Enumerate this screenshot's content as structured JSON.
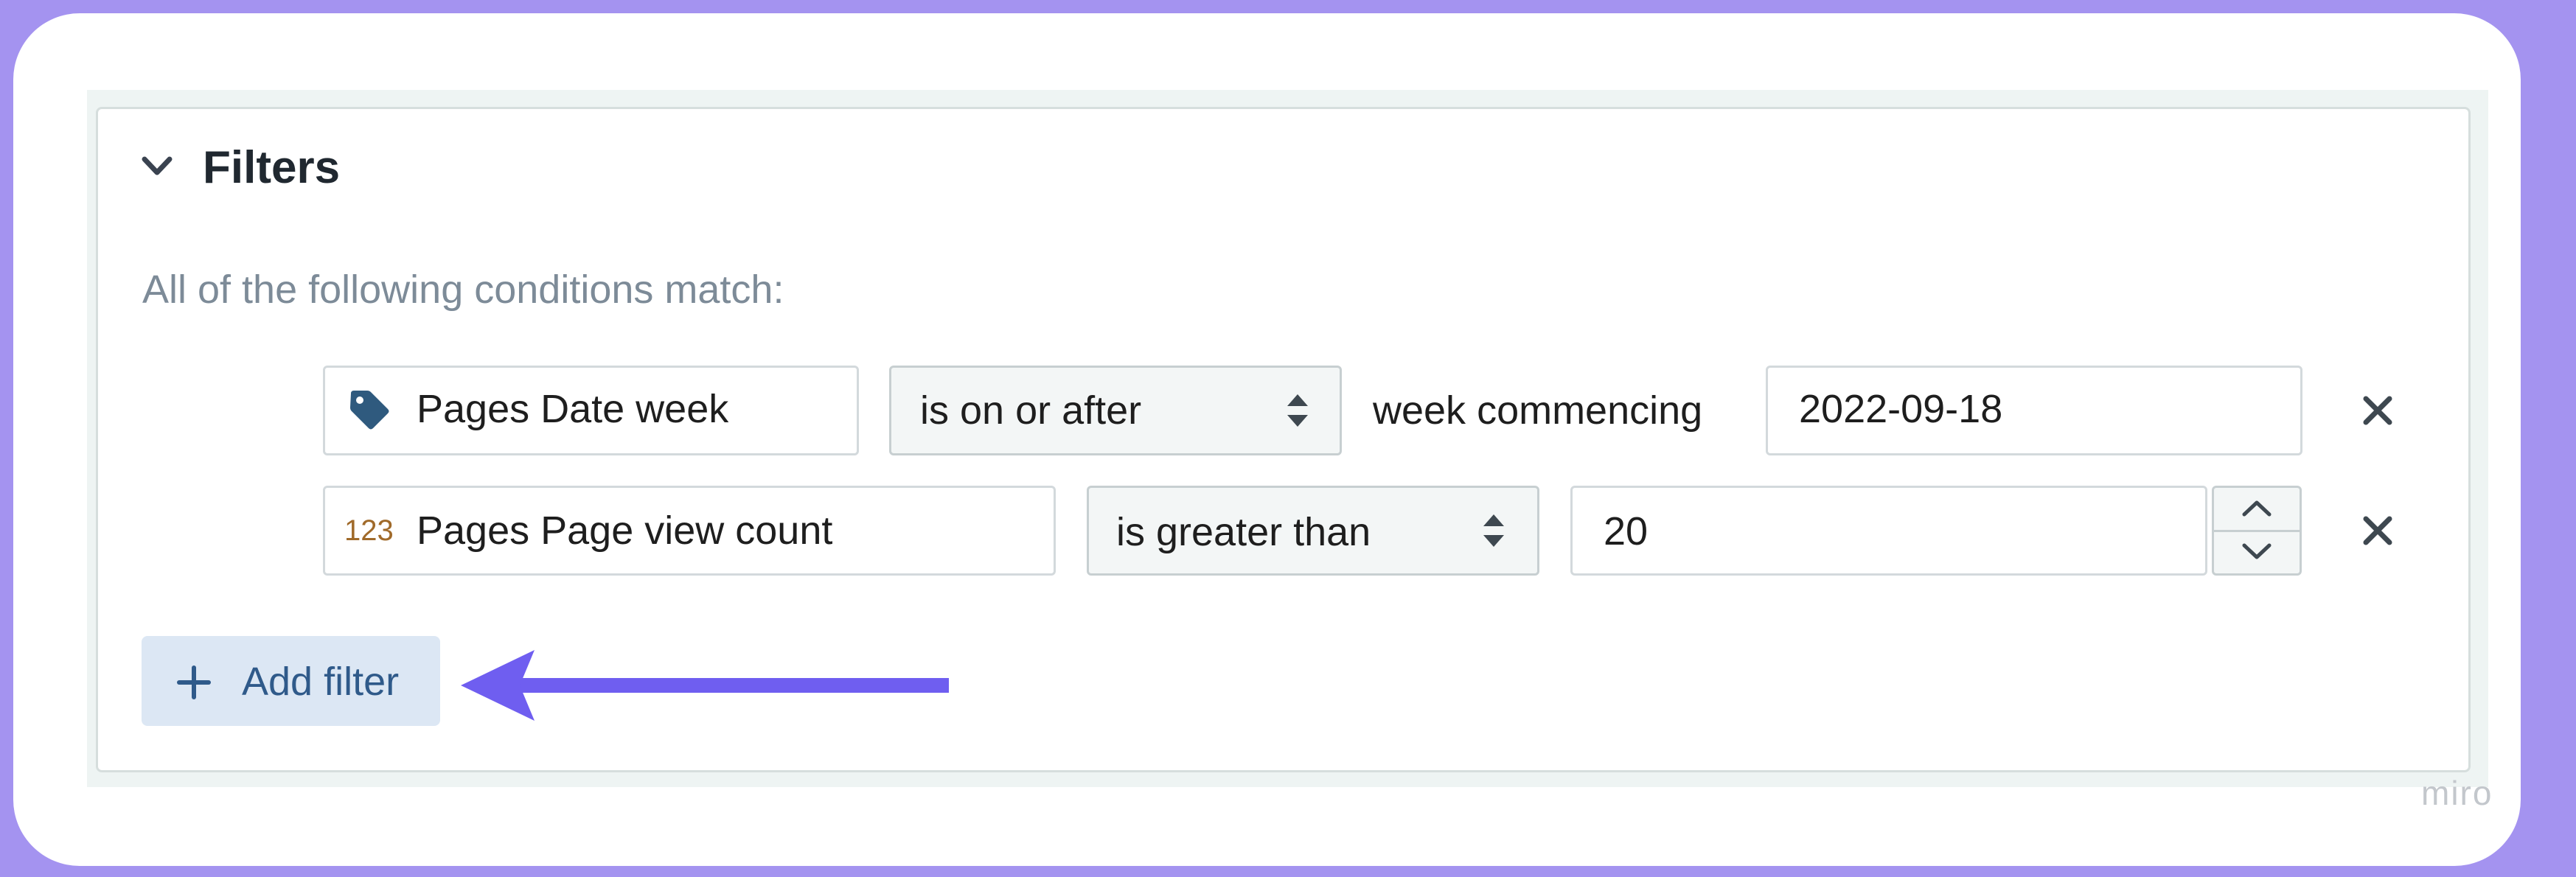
{
  "filters": {
    "title": "Filters",
    "subtitle": "All of the following conditions match:",
    "rows": [
      {
        "field_icon": "tag-icon",
        "field": "Pages Date week",
        "operator": "is on or after",
        "qualifier": "week commencing",
        "value": "2022-09-18"
      },
      {
        "field_icon": "123",
        "field": "Pages Page view count",
        "operator": "is greater than",
        "value": "20"
      }
    ],
    "add_filter_label": "Add filter"
  },
  "annotation": {
    "arrow_color": "#6f5ef0"
  },
  "watermark": "miro",
  "colors": {
    "background": "#a493f0",
    "tag_icon": "#2f5a7e",
    "number_icon": "#a06a2a",
    "add_button_bg": "#dce7f4",
    "add_button_text": "#2f5a8a"
  }
}
